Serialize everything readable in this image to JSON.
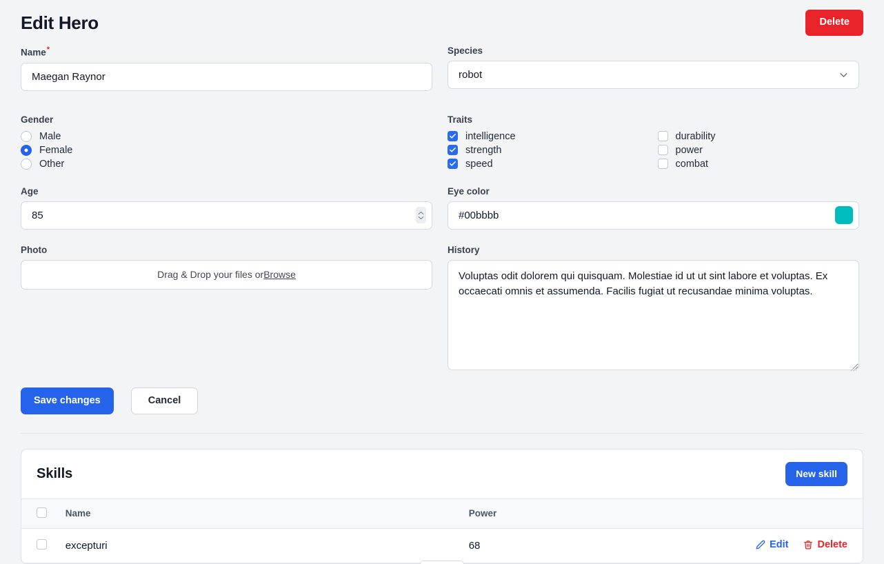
{
  "header": {
    "title": "Edit Hero",
    "delete_label": "Delete"
  },
  "form": {
    "name": {
      "label": "Name",
      "required_marker": "*",
      "value": "Maegan Raynor",
      "placeholder": "Name"
    },
    "species": {
      "label": "Species",
      "value": "robot",
      "options": [
        "robot"
      ]
    },
    "gender": {
      "label": "Gender",
      "selected": "Female",
      "options": [
        {
          "label": "Male",
          "checked": false
        },
        {
          "label": "Female",
          "checked": true
        },
        {
          "label": "Other",
          "checked": false
        }
      ]
    },
    "traits": {
      "label": "Traits",
      "options": [
        {
          "label": "intelligence",
          "checked": true
        },
        {
          "label": "durability",
          "checked": false
        },
        {
          "label": "strength",
          "checked": true
        },
        {
          "label": "power",
          "checked": false
        },
        {
          "label": "speed",
          "checked": true
        },
        {
          "label": "combat",
          "checked": false
        }
      ]
    },
    "age": {
      "label": "Age",
      "value": "85",
      "placeholder": "Age"
    },
    "eye_color": {
      "label": "Eye color",
      "value": "#00bbbb",
      "placeholder": "#000000",
      "swatch": "#00bbbb"
    },
    "photo": {
      "label": "Photo",
      "dropzone_text": "Drag & Drop your files or ",
      "browse_label": "Browse"
    },
    "history": {
      "label": "History",
      "value": "Voluptas odit dolorem qui quisquam. Molestiae id ut ut sint labore et voluptas. Ex occaecati omnis et assumenda. Facilis fugiat ut recusandae minima voluptas.",
      "placeholder": "History"
    },
    "actions": {
      "save_label": "Save changes",
      "cancel_label": "Cancel"
    }
  },
  "skills": {
    "title": "Skills",
    "new_label": "New skill",
    "columns": [
      "",
      "Name",
      "Power",
      ""
    ],
    "rows": [
      {
        "selected": false,
        "name": "excepturi",
        "power": "68",
        "edit_label": "Edit",
        "delete_label": "Delete"
      }
    ]
  },
  "colors": {
    "primary": "#2563eb",
    "danger": "#e8232a",
    "eye": "#00bbbb",
    "page_bg": "#f3f4f6"
  }
}
